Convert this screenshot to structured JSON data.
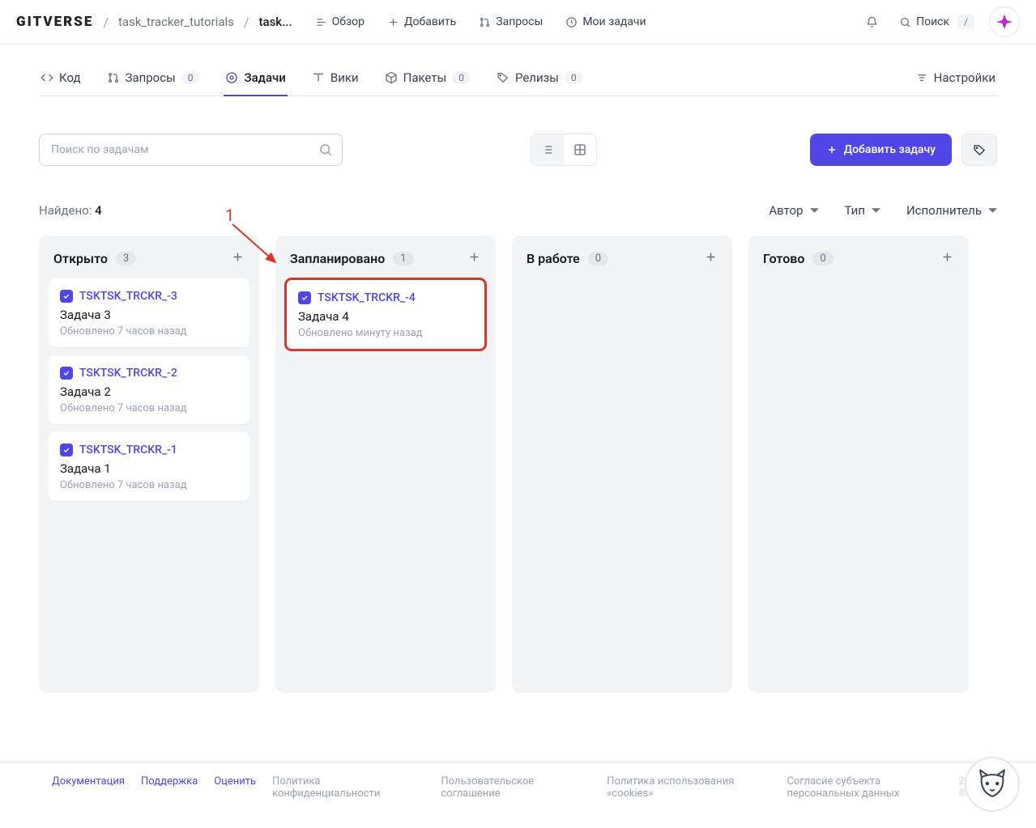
{
  "topbar": {
    "logo": "GITVERSE",
    "crumb1": "task_tracker_tutorials",
    "crumb2": "task...",
    "nav": {
      "overview": "Обзор",
      "add": "Добавить",
      "requests": "Запросы",
      "mytasks": "Мои задачи",
      "search": "Поиск",
      "kbd": "/"
    }
  },
  "tabs": {
    "code": "Код",
    "requests": "Запросы",
    "requests_n": "0",
    "tasks": "Задачи",
    "wiki": "Вики",
    "packages": "Пакеты",
    "packages_n": "0",
    "releases": "Релизы",
    "releases_n": "0",
    "settings": "Настройки"
  },
  "search": {
    "placeholder": "Поиск по задачам"
  },
  "actions": {
    "add_task": "Добавить задачу"
  },
  "meta": {
    "found_label": "Найдено:",
    "found_n": "4"
  },
  "filters": {
    "author": "Автор",
    "type": "Тип",
    "assignee": "Исполнитель"
  },
  "annot": {
    "num": "1"
  },
  "columns": [
    {
      "title": "Открыто",
      "count": "3",
      "cards": [
        {
          "id": "TSKTSK_TRCKR_-3",
          "title": "Задача 3",
          "sub": "Обновлено 7 часов назад"
        },
        {
          "id": "TSKTSK_TRCKR_-2",
          "title": "Задача 2",
          "sub": "Обновлено 7 часов назад"
        },
        {
          "id": "TSKTSK_TRCKR_-1",
          "title": "Задача 1",
          "sub": "Обновлено 7 часов назад"
        }
      ]
    },
    {
      "title": "Запланировано",
      "count": "1",
      "cards": [
        {
          "id": "TSKTSK_TRCKR_-4",
          "title": "Задача 4",
          "sub": "Обновлено минуту назад",
          "hl": true
        }
      ]
    },
    {
      "title": "В работе",
      "count": "0",
      "cards": []
    },
    {
      "title": "Готово",
      "count": "0",
      "cards": []
    }
  ],
  "footer": {
    "docs": "Документация",
    "support": "Поддержка",
    "rate": "Оценить",
    "privacy": "Политика конфиденциальности",
    "terms": "Пользовательское соглашение",
    "cookies": "Политика использования «cookies»",
    "personal": "Согласие субъекта персональных данных",
    "year": "2025 ©"
  }
}
